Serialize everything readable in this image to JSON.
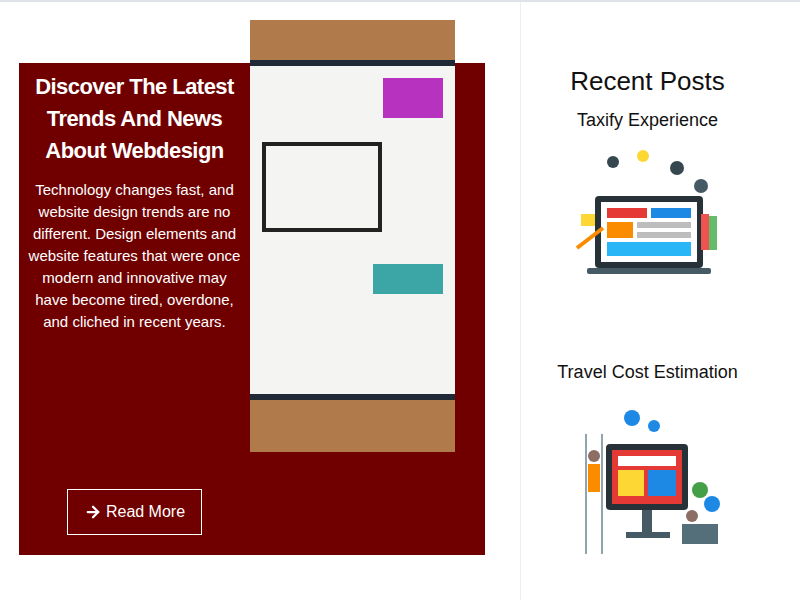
{
  "hero": {
    "title": "Discover The Latest Trends And News About Webdesign",
    "body": "Technology changes fast, and website design trends are no different. Design elements and website features that were once modern and innovative may have become tired, overdone, and cliched in recent years.",
    "button": "Read More"
  },
  "sidebar": {
    "title": "Recent Posts",
    "posts": [
      {
        "title": "Taxify Experience"
      },
      {
        "title": "Travel Cost Estimation"
      }
    ]
  }
}
